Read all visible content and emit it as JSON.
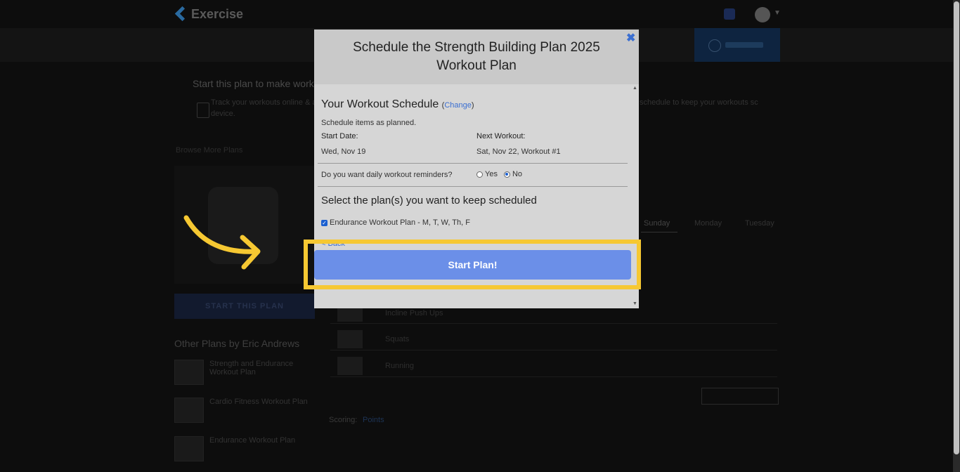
{
  "app": {
    "name": "Exercise"
  },
  "background": {
    "intro_title": "Start this plan to make work",
    "intro_text_left": "Track your workouts online & a",
    "intro_text_left2": "device.",
    "intro_text_right": "schedule to keep your workouts sc",
    "back_link": "Browse More Plans",
    "start_plan_button": "START THIS PLAN",
    "other_plans_heading": "Other Plans by Eric Andrews",
    "other_plans": [
      "Strength and Endurance Workout Plan",
      "Cardio Fitness Workout Plan",
      "Endurance Workout Plan"
    ],
    "day_tabs": [
      "Sunday",
      "Monday",
      "Tuesday"
    ],
    "rows": [
      "Incline Push Ups",
      "Squats",
      "Running"
    ],
    "scoring_label": "Scoring:",
    "scoring_value": "Points"
  },
  "modal": {
    "title": "Schedule the Strength Building Plan 2025 Workout Plan",
    "schedule_heading": "Your Workout Schedule",
    "change_link": "Change",
    "schedule_note": "Schedule items as planned.",
    "start_date_label": "Start Date:",
    "start_date_value": "Wed, Nov 19",
    "next_workout_label": "Next Workout:",
    "next_workout_value": "Sat, Nov 22, Workout #1",
    "reminder_question": "Do you want daily workout reminders?",
    "reminder_yes": "Yes",
    "reminder_no": "No",
    "reminder_selected": "No",
    "select_heading": "Select the plan(s) you want to keep scheduled",
    "plans": [
      {
        "label": "Endurance Workout Plan - M, T, W, Th, F",
        "checked": true
      }
    ],
    "back_link": "< Back",
    "start_button": "Start Plan!"
  },
  "colors": {
    "accent": "#6b8fe8",
    "link": "#3b6fd1",
    "highlight": "#f6c832",
    "arrow": "#f6c832"
  }
}
